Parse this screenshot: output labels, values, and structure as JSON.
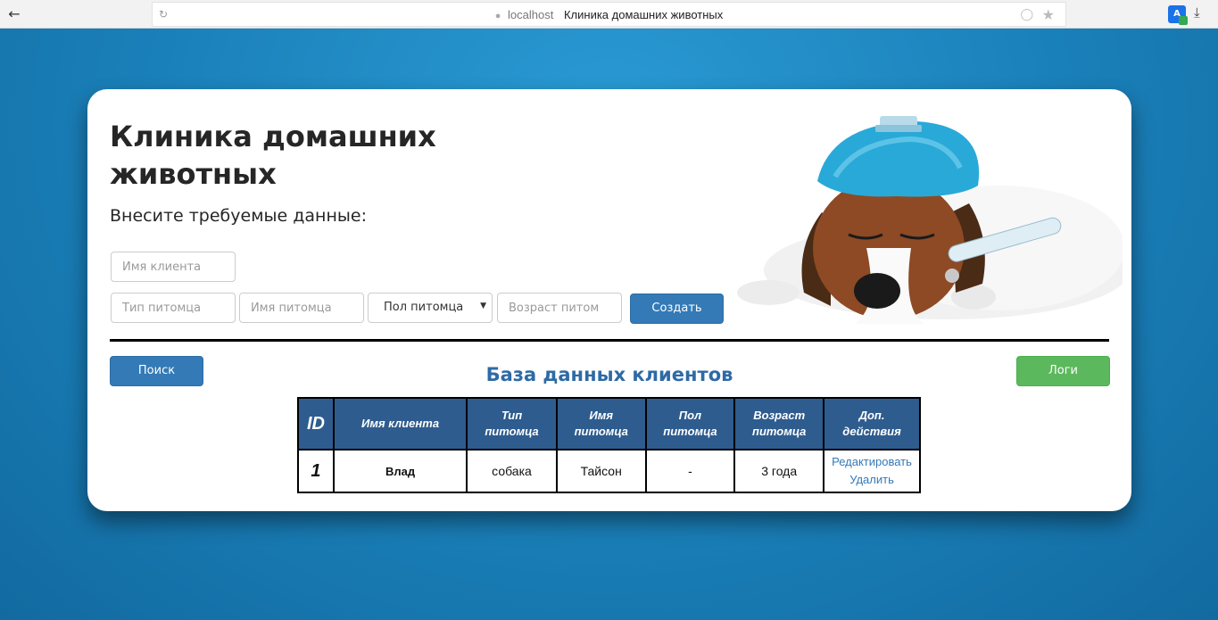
{
  "browser": {
    "host": "localhost",
    "tab_title": "Клиника домашних животных"
  },
  "header": {
    "title": "Клиника домашних животных",
    "subtitle": "Внесите требуемые данные:"
  },
  "form": {
    "client_name_placeholder": "Имя клиента",
    "pet_type_placeholder": "Тип питомца",
    "pet_name_placeholder": "Имя питомца",
    "pet_sex_selected": "Пол питомца",
    "pet_age_placeholder": "Возраст питом",
    "create_label": "Создать"
  },
  "actions": {
    "search_label": "Поиск",
    "logs_label": "Логи"
  },
  "database": {
    "title": "База данных клиентов",
    "columns": [
      "ID",
      "Имя клиента",
      "Тип питомца",
      "Имя питомца",
      "Пол питомца",
      "Возраст питомца",
      "Доп. действия"
    ],
    "rows": [
      {
        "id": "1",
        "client_name": "Влад",
        "pet_type": "собака",
        "pet_name": "Тайсон",
        "pet_sex": "-",
        "pet_age": "3 года",
        "edit_label": "Редактировать",
        "delete_label": "Удалить"
      }
    ]
  },
  "colors": {
    "background": "#1e86c0",
    "primary_button": "#337ab7",
    "success_button": "#5cb85c",
    "table_header": "#2e5c8e",
    "db_title": "#2e6aa6"
  }
}
